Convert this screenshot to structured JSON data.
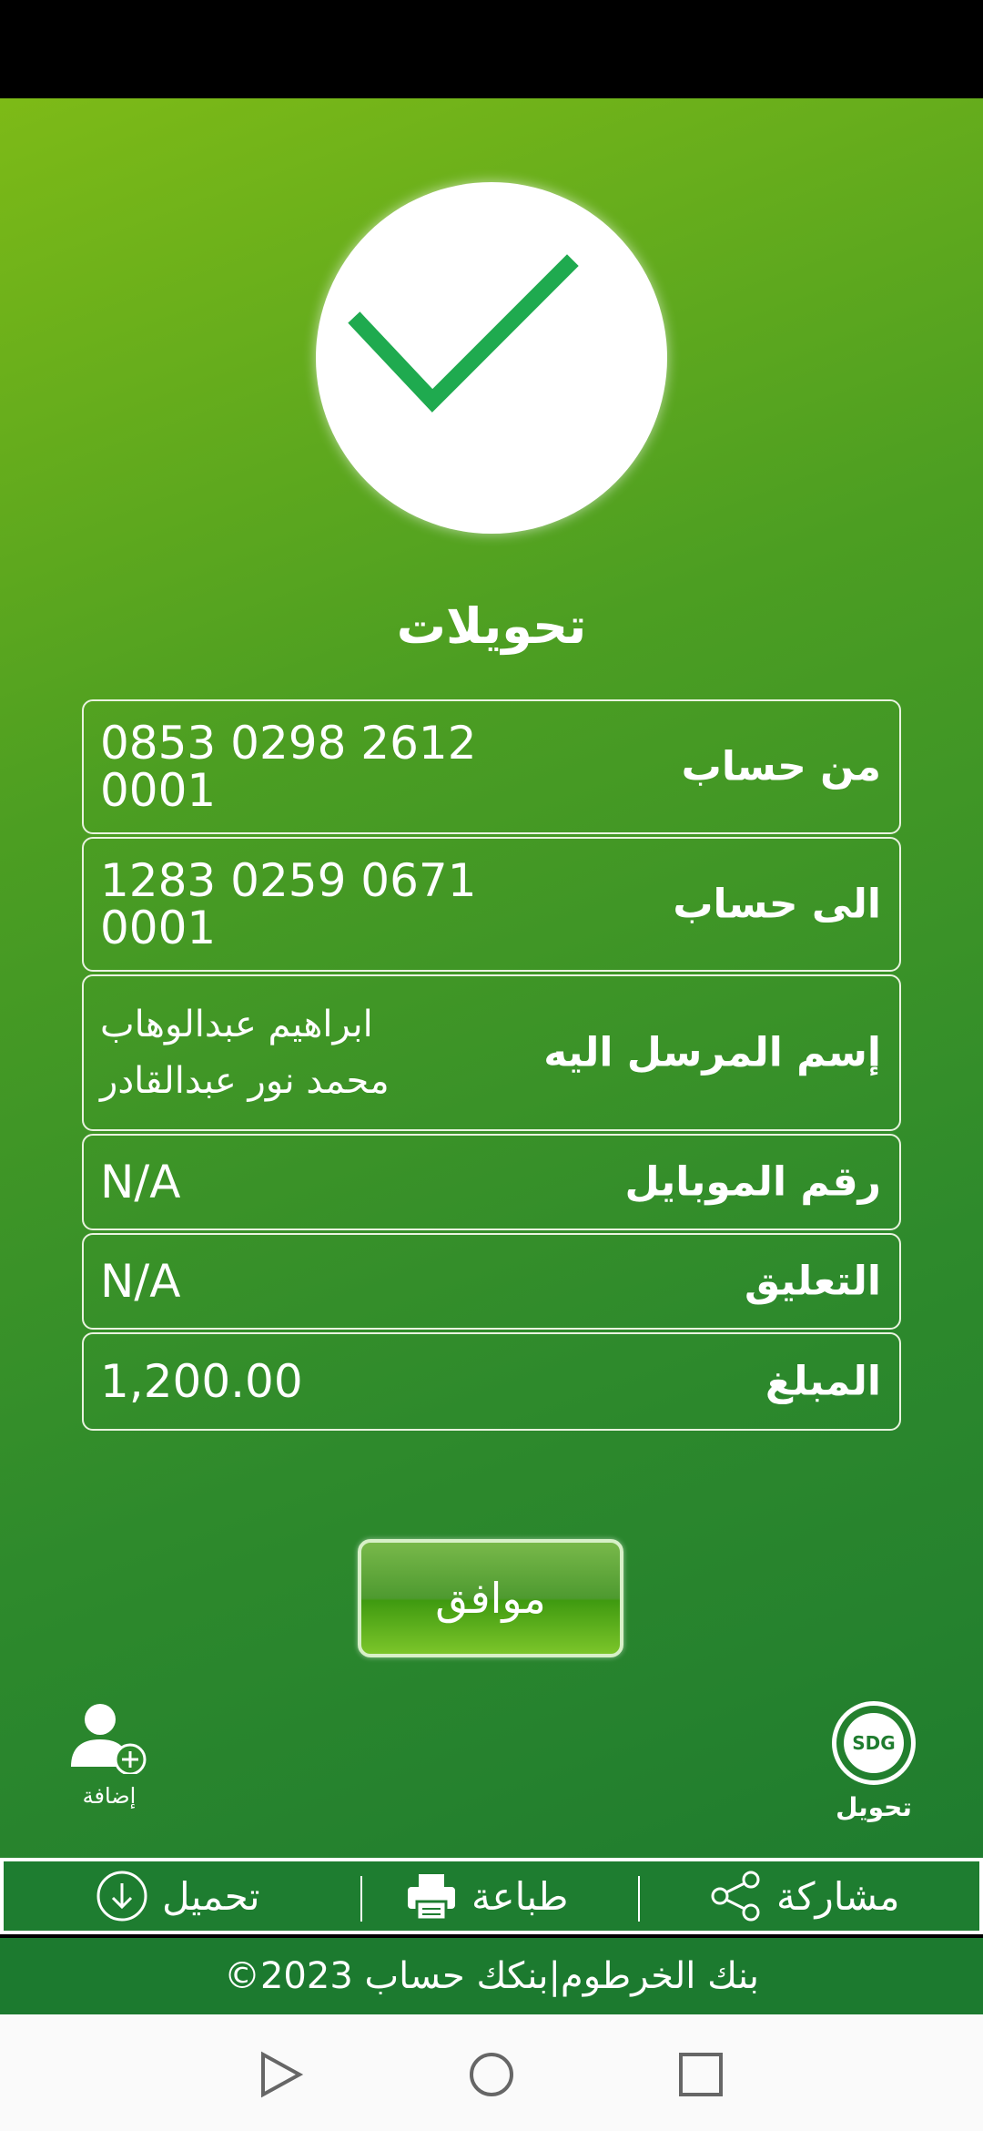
{
  "title": "تحويلات",
  "details": [
    {
      "label": "من حساب",
      "value": "0853 0298 2612 0001"
    },
    {
      "label": "الى حساب",
      "value": "1283 0259 0671 0001"
    },
    {
      "label": "إسم المرسل اليه",
      "value": "ابراهيم عبدالوهاب محمد نور عبدالقادر"
    },
    {
      "label": "رقم الموبايل",
      "value": "N/A"
    },
    {
      "label": "التعليق",
      "value": "N/A"
    },
    {
      "label": "المبلغ",
      "value": "1,200.00"
    }
  ],
  "ok_label": "موافق",
  "add_contact_label": "إضافة",
  "sdg_badge": "SDG",
  "transfer_label": "تحويل",
  "actions": {
    "download": "تحميل",
    "print": "طباعة",
    "share": "مشاركة"
  },
  "footer": "©2023 بنك الخرطوم|بنكك حساب",
  "colors": {
    "brand_green": "#1f7c2f",
    "light_green": "#7dba17",
    "check_green": "#1faa4f"
  }
}
